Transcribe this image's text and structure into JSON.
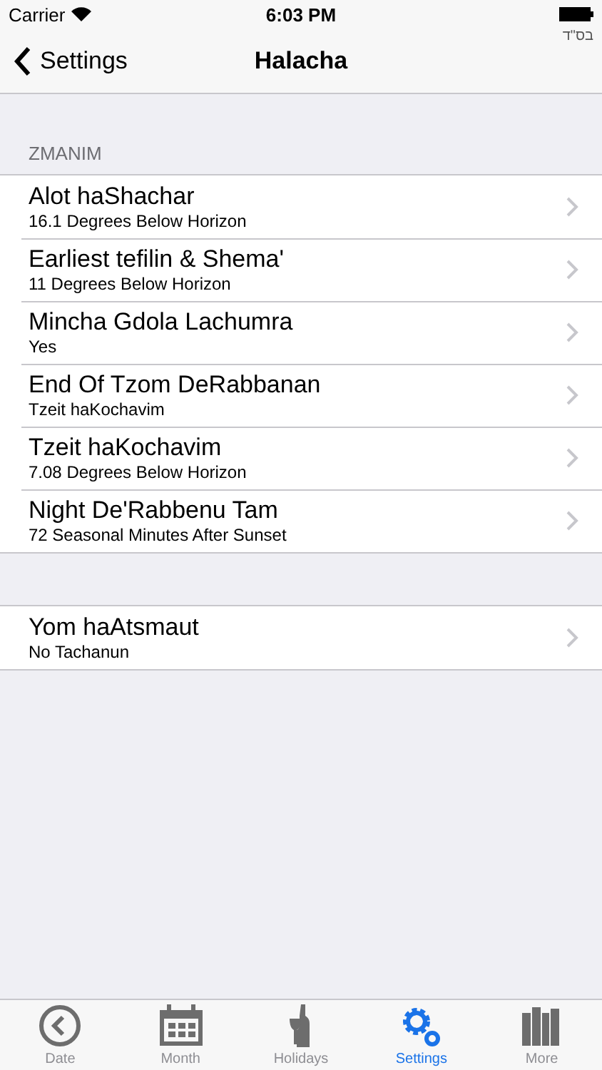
{
  "status_bar": {
    "carrier": "Carrier",
    "time": "6:03 PM"
  },
  "nav": {
    "back": "Settings",
    "title": "Halacha",
    "corner_note": "בס\"ד"
  },
  "sections": [
    {
      "header": "ZMANIM",
      "rows": [
        {
          "title": "Alot haShachar",
          "subtitle": "16.1 Degrees Below Horizon"
        },
        {
          "title": "Earliest tefilin & Shema'",
          "subtitle": "11 Degrees Below Horizon"
        },
        {
          "title": "Mincha Gdola Lachumra",
          "subtitle": "Yes"
        },
        {
          "title": "End Of Tzom DeRabbanan",
          "subtitle": "Tzeit haKochavim"
        },
        {
          "title": "Tzeit haKochavim",
          "subtitle": "7.08 Degrees Below Horizon"
        },
        {
          "title": "Night De'Rabbenu Tam",
          "subtitle": "72 Seasonal Minutes After Sunset"
        }
      ]
    },
    {
      "rows": [
        {
          "title": "Yom haAtsmaut",
          "subtitle": "No Tachanun"
        }
      ]
    }
  ],
  "tabs": [
    {
      "label": "Date",
      "kind": "clock",
      "selected": false
    },
    {
      "label": "Month",
      "kind": "calendar",
      "selected": false
    },
    {
      "label": "Holidays",
      "kind": "wine",
      "selected": false
    },
    {
      "label": "Settings",
      "kind": "gears",
      "selected": true
    },
    {
      "label": "More",
      "kind": "books",
      "selected": false
    }
  ]
}
